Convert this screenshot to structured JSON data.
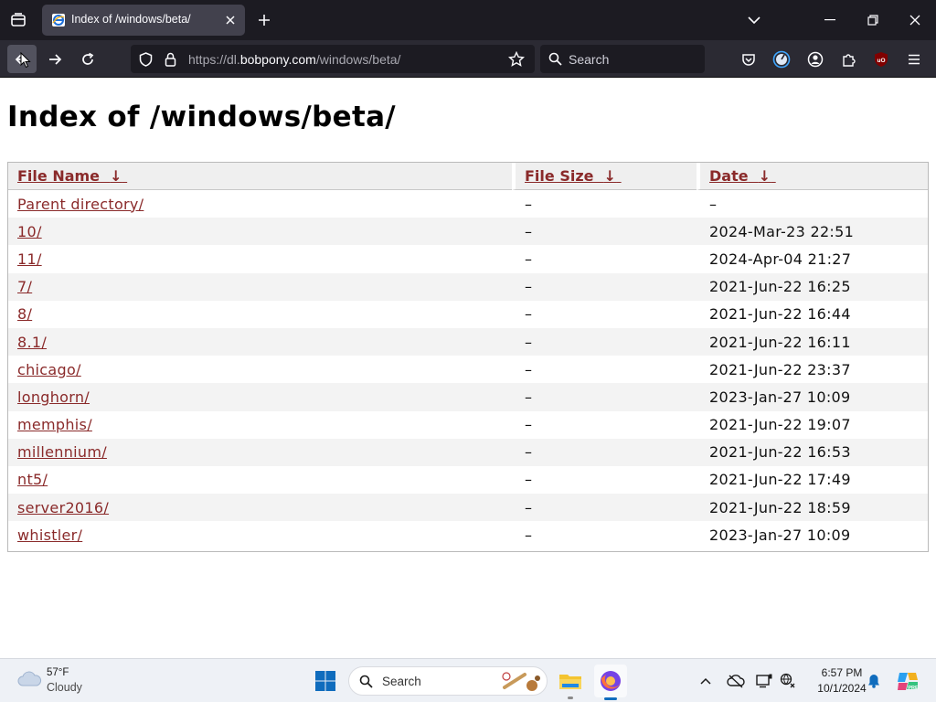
{
  "browser": {
    "tab": {
      "title": "Index of /windows/beta/",
      "favicon": "ie-globe-icon"
    },
    "address": {
      "url_prefix": "https://dl.",
      "url_host": "bobpony.com",
      "url_path": "/windows/beta/"
    },
    "search_placeholder": "Search",
    "colors": {
      "chrome_dark": "#1c1b22",
      "toolbar": "#2b2a33",
      "ublock_red": "#800000"
    }
  },
  "page": {
    "heading": "Index of /windows/beta/",
    "columns": [
      {
        "label": "File Name",
        "sort_icon": "↓"
      },
      {
        "label": "File Size",
        "sort_icon": "↓"
      },
      {
        "label": "Date",
        "sort_icon": "↓"
      }
    ],
    "rows": [
      {
        "name": "Parent directory/",
        "size": "–",
        "date": "–"
      },
      {
        "name": "10/",
        "size": "–",
        "date": "2024-Mar-23 22:51"
      },
      {
        "name": "11/",
        "size": "–",
        "date": "2024-Apr-04 21:27"
      },
      {
        "name": "7/",
        "size": "–",
        "date": "2021-Jun-22 16:25"
      },
      {
        "name": "8/",
        "size": "–",
        "date": "2021-Jun-22 16:44"
      },
      {
        "name": "8.1/",
        "size": "–",
        "date": "2021-Jun-22 16:11"
      },
      {
        "name": "chicago/",
        "size": "–",
        "date": "2021-Jun-22 23:37"
      },
      {
        "name": "longhorn/",
        "size": "–",
        "date": "2023-Jan-27 10:09"
      },
      {
        "name": "memphis/",
        "size": "–",
        "date": "2021-Jun-22 19:07"
      },
      {
        "name": "millennium/",
        "size": "–",
        "date": "2021-Jun-22 16:53"
      },
      {
        "name": "nt5/",
        "size": "–",
        "date": "2021-Jun-22 17:49"
      },
      {
        "name": "server2016/",
        "size": "–",
        "date": "2021-Jun-22 18:59"
      },
      {
        "name": "whistler/",
        "size": "–",
        "date": "2023-Jan-27 10:09"
      }
    ],
    "colors": {
      "link": "#8a2a2a",
      "header_bg": "#efefef",
      "stripe_bg": "#f3f3f3"
    }
  },
  "taskbar": {
    "weather": {
      "temp": "57°F",
      "condition": "Cloudy"
    },
    "search_label": "Search",
    "clock": {
      "time": "6:57 PM",
      "date": "10/1/2024"
    },
    "colors": {
      "windows_blue": "#0f6cbd",
      "folder_yellow": "#f4c430",
      "firefox_orange": "#ff7139"
    }
  }
}
